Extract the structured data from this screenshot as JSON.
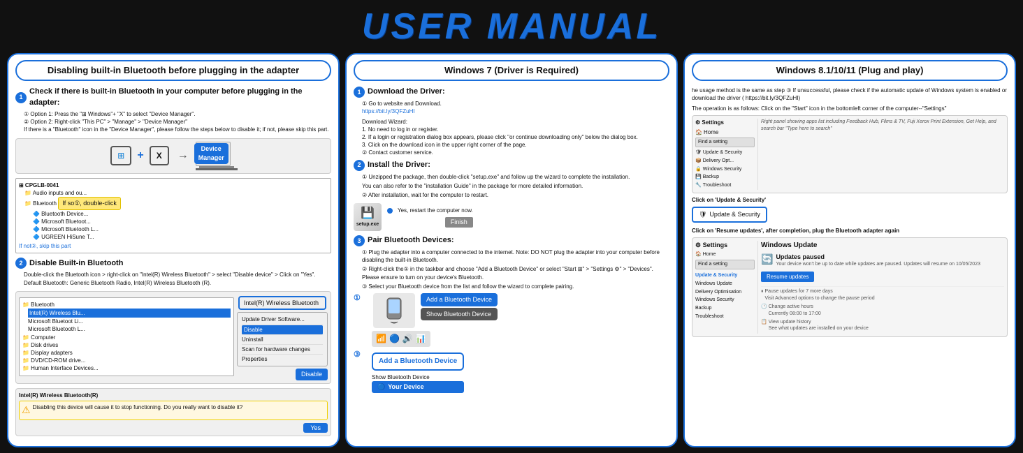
{
  "title": "USER MANUAL",
  "col1": {
    "header": "Disabling built-in Bluetooth before plugging in the adapter",
    "section1_title": "Check if there is built-in Bluetooth in your computer before plugging in the adapter:",
    "section1_steps": [
      "Option 1: Press the \"⊞ Windows\"+ \"X\" to select \"Device Manager\".",
      "Option 2: Right-click \"This PC\" > \"Manage\" > \"Device Manager\"",
      "If there is a \"Bluetooth\" icon in the \"Device Manager\", please follow the steps below to disable it; if not, please skip this part."
    ],
    "device_manager_label": "Device Manager",
    "if_so_label": "If so①, double-click",
    "if_not_label": "If not②, skip this part",
    "section2_title": "Disable Built-in Bluetooth",
    "section2_text": "Double-click the Bluetooth icon > right-click on \"Intel(R) Wireless Bluetooth\" > select \"Disable device\" > Click on \"Yes\".",
    "section2_default": "Default Bluetooth: Generic Bluetooth Radio, Intel(R) Wireless Bluetooth (R).",
    "intel_wireless_label": "Intel(R) Wireless Bluetooth",
    "disable_label": "Disable",
    "yes_label": "Yes",
    "tree_items": [
      "Bluetooth",
      "Intel(R) Wireless Blu...",
      "Microsoft Bluetooth L...",
      "Microsoft Bluetooth LE...",
      "UGREEN HiSune Ti"
    ]
  },
  "col2": {
    "header": "Windows 7 (Driver is Required)",
    "section1_title": "Download the Driver:",
    "download_steps": [
      "Go to website and Download.",
      "https://bit.ly/3QFZuHI"
    ],
    "wizard_title": "Download Wizard:",
    "wizard_steps": [
      "No need to log in or register.",
      "If a login or registration dialog box appears, please click \"or continue downloading only\" below the dialog box.",
      "Click on the download icon in the upper right corner of the page.",
      "Contact customer service."
    ],
    "section2_title": "Install the Driver:",
    "install_steps": [
      "Unzipped the package, then double-click \"setup.exe\" and follow up the wizard to complete the installation.",
      "You can also refer to the \"installation Guide\" in the package for more detailed information.",
      "After installation, wait for the computer to restart."
    ],
    "setup_label": "setup.exe",
    "restart_label": "Yes, restart the computer now.",
    "finish_label": "Finish",
    "section3_title": "Pair Bluetooth Devices:",
    "pair_steps": [
      "Plug the adapter into a computer connected to the internet. Note: DO NOT plug the adapter into your computer before disabling the built-in Bluetooth.",
      "Right-click the① in the taskbar and choose \"Add a Bluetooth Device\" or select \"Start ⊞\" > \"Settings ⚙\" > \"Devices\". Please ensure to turn on your device's Bluetooth.",
      "Select your Bluetooth device from the list and follow the wizard to complete pairing."
    ],
    "add_bt_label": "Add a Bluetooth Device",
    "show_bt_label": "Show Bluetooth Device",
    "add_bt_label2": "Add a Bluetooth Device",
    "show_bt_label2": "Show Bluetooth Device",
    "your_device_label": "Your Device"
  },
  "col3": {
    "header": "Windows 8.1/10/11 (Plug and play)",
    "intro_text": "he usage method is the same as step ③ If unsuccessful, please check if the automatic update of Windows system is enabled or download the driver ( https://bit.ly/3QFZuHI)",
    "operation_text": "The operation is as follows: Click on the \"Start\" icon in the bottomleft corner of the computer--\"Settings\"",
    "update_security_label": "Click on 'Update & Security'",
    "update_security_btn": "Update & Security",
    "resume_text": "Click on 'Resume updates', after completion, plug the Bluetooth adapter again",
    "settings_title": "Settings",
    "home_label": "Home",
    "search_placeholder": "Find a setting",
    "win_update_label": "Windows Update",
    "updates_paused_label": "Updates paused",
    "updates_paused_detail": "Your device won't be up to date while updates are paused. Updates will resume on 10/05/2023",
    "resume_btn_label": "Resume updates",
    "delivery_label": "Delivery Optimisation",
    "win_security_label": "Windows Security",
    "backup_label": "Backup",
    "troubleshoot_label": "Troubleshoot",
    "pause_label": "Pause updates for 7 more days",
    "pause_detail": "Visit Advanced options to change the pause period",
    "active_hours_label": "Change active hours",
    "active_hours_detail": "Currently 08:00 to 17:00",
    "update_history_label": "View update history",
    "update_history_detail": "See what updates are installed on your device",
    "update_security_sidebar_label": "Update & Security"
  }
}
